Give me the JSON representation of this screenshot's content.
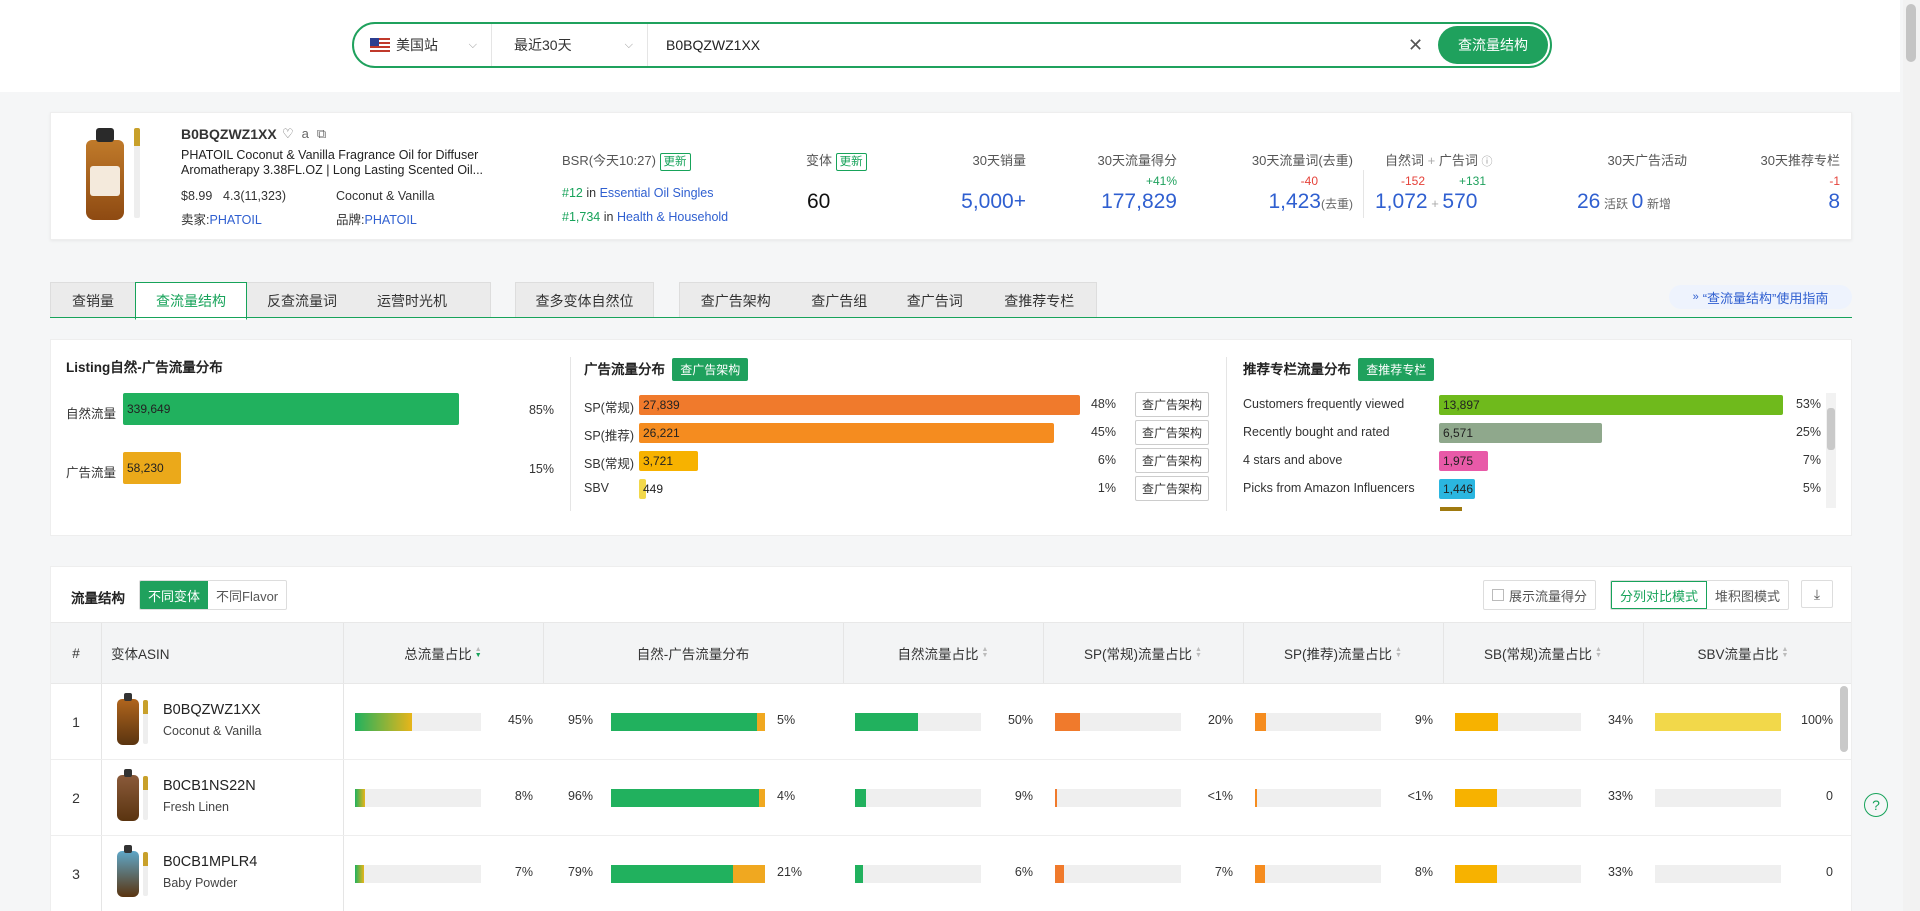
{
  "search": {
    "site": "美国站",
    "range": "最近30天",
    "query": "B0BQZWZ1XX",
    "clear_icon": "close-icon",
    "button": "查流量结构"
  },
  "product": {
    "asin": "B0BQZWZ1XX",
    "icons": [
      "heart-icon",
      "amazon-icon",
      "copy-icon"
    ],
    "title": "PHATOIL Coconut & Vanilla Fragrance Oil for Diffuser Aromatherapy 3.38FL.OZ | Long Lasting Scented Oil...",
    "price": "$8.99",
    "rating": "4.3(11,323)",
    "variant": "Coconut & Vanilla",
    "seller_label": "卖家:",
    "seller": "PHATOIL",
    "brand_label": "品牌:",
    "brand": "PHATOIL",
    "bsr_label": "BSR(今天10:27)",
    "update": "更新",
    "rank1_num": "#12",
    "rank1_in": "in",
    "rank1_cat": "Essential Oil Singles",
    "rank2_num": "#1,734",
    "rank2_in": "in",
    "rank2_cat": "Health & Household"
  },
  "metrics": {
    "variants_label": "变体",
    "variants_value": "60",
    "sales_label": "30天销量",
    "sales_value": "5,000+",
    "score_label": "30天流量得分",
    "score_delta": "+41%",
    "score_value": "177,829",
    "words_label": "30天流量词(去重)",
    "words_delta": "-40",
    "words_value": "1,423",
    "words_suffix": "(去重)",
    "organic_label": "自然词",
    "plus": "+",
    "ad_label": "广告词",
    "organic_delta": "-152",
    "organic_value": "1,072",
    "ad_delta": "+131",
    "ad_value": "570",
    "campaign_label": "30天广告活动",
    "campaign_active": "26",
    "campaign_active_label": "活跃",
    "campaign_new": "0",
    "campaign_new_label": "新增",
    "rec_label": "30天推荐专栏",
    "rec_delta": "-1",
    "rec_value": "8"
  },
  "tabs": {
    "group1": [
      "查销量",
      "查流量结构",
      "反查流量词",
      "运营时光机"
    ],
    "group2": [
      "查多变体自然位"
    ],
    "group3": [
      "查广告架构",
      "查广告组",
      "查广告词",
      "查推荐专栏"
    ],
    "active": "查流量结构",
    "guide": "“查流量结构”使用指南"
  },
  "listing_dist": {
    "title": "Listing自然-广告流量分布",
    "rows": [
      {
        "label": "自然流量",
        "value": "339,649",
        "pct": "85%",
        "frac": 0.85,
        "color": "#21b15e"
      },
      {
        "label": "广告流量",
        "value": "58,230",
        "pct": "15%",
        "frac": 0.146,
        "color": "#eba91a"
      }
    ]
  },
  "ad_dist": {
    "title": "广告流量分布",
    "button": "查广告架构",
    "row_button": "查广告架构",
    "rows": [
      {
        "label": "SP(常规)",
        "value": "27,839",
        "pct": "48%",
        "frac": 1.0,
        "color": "#f07a2c"
      },
      {
        "label": "SP(推荐)",
        "value": "26,221",
        "pct": "45%",
        "frac": 0.94,
        "color": "#f58c1f"
      },
      {
        "label": "SB(常规)",
        "value": "3,721",
        "pct": "6%",
        "frac": 0.134,
        "color": "#f7b200"
      },
      {
        "label": "SBV",
        "value": "449",
        "pct": "1%",
        "frac": 0.016,
        "color": "#f2d84a"
      }
    ]
  },
  "rec_dist": {
    "title": "推荐专栏流量分布",
    "button": "查推荐专栏",
    "rows": [
      {
        "label": "Customers frequently viewed",
        "value": "13,897",
        "pct": "53%",
        "frac": 1.0,
        "color": "#6fba1c"
      },
      {
        "label": "Recently bought and rated",
        "value": "6,571",
        "pct": "25%",
        "frac": 0.473,
        "color": "#8fa88c"
      },
      {
        "label": "4 stars and above",
        "value": "1,975",
        "pct": "7%",
        "frac": 0.142,
        "color": "#e85aa8"
      },
      {
        "label": "Picks from Amazon Influencers",
        "value": "1,446",
        "pct": "5%",
        "frac": 0.104,
        "color": "#2bb6e0"
      }
    ]
  },
  "table": {
    "title": "流量结构",
    "seg1": [
      "不同变体",
      "不同Flavor"
    ],
    "show_score": "展示流量得分",
    "mode": [
      "分列对比模式",
      "堆积图模式"
    ],
    "download_icon": "download-icon",
    "headers": [
      "#",
      "变体ASIN",
      "总流量占比",
      "自然-广告流量分布",
      "自然流量占比",
      "SP(常规)流量占比",
      "SP(推荐)流量占比",
      "SB(常规)流量占比",
      "SBV流量占比"
    ],
    "rows": [
      {
        "idx": "1",
        "asin": "B0BQZWZ1XX",
        "name": "Coconut & Vanilla",
        "thumb": "#b0651d",
        "total": "45%",
        "total_frac": 0.45,
        "org": "95%",
        "ad": "5%",
        "org_frac": 0.95,
        "nat": "50%",
        "nat_frac": 0.5,
        "spc": "20%",
        "spc_frac": 0.2,
        "spr": "9%",
        "spr_frac": 0.09,
        "sbc": "34%",
        "sbc_frac": 0.34,
        "sbv": "100%",
        "sbv_frac": 1.0
      },
      {
        "idx": "2",
        "asin": "B0CB1NS22N",
        "name": "Fresh Linen",
        "thumb": "#8a5a3a",
        "total": "8%",
        "total_frac": 0.08,
        "org": "96%",
        "ad": "4%",
        "org_frac": 0.96,
        "nat": "9%",
        "nat_frac": 0.09,
        "spc": "<1%",
        "spc_frac": 0.01,
        "spr": "<1%",
        "spr_frac": 0.01,
        "sbc": "33%",
        "sbc_frac": 0.33,
        "sbv": "0",
        "sbv_frac": 0
      },
      {
        "idx": "3",
        "asin": "B0CB1MPLR4",
        "name": "Baby Powder",
        "thumb": "#5fa7c8",
        "total": "7%",
        "total_frac": 0.07,
        "org": "79%",
        "ad": "21%",
        "org_frac": 0.79,
        "nat": "6%",
        "nat_frac": 0.06,
        "spc": "7%",
        "spc_frac": 0.07,
        "spr": "8%",
        "spr_frac": 0.08,
        "sbc": "33%",
        "sbc_frac": 0.33,
        "sbv": "0",
        "sbv_frac": 0
      }
    ]
  }
}
